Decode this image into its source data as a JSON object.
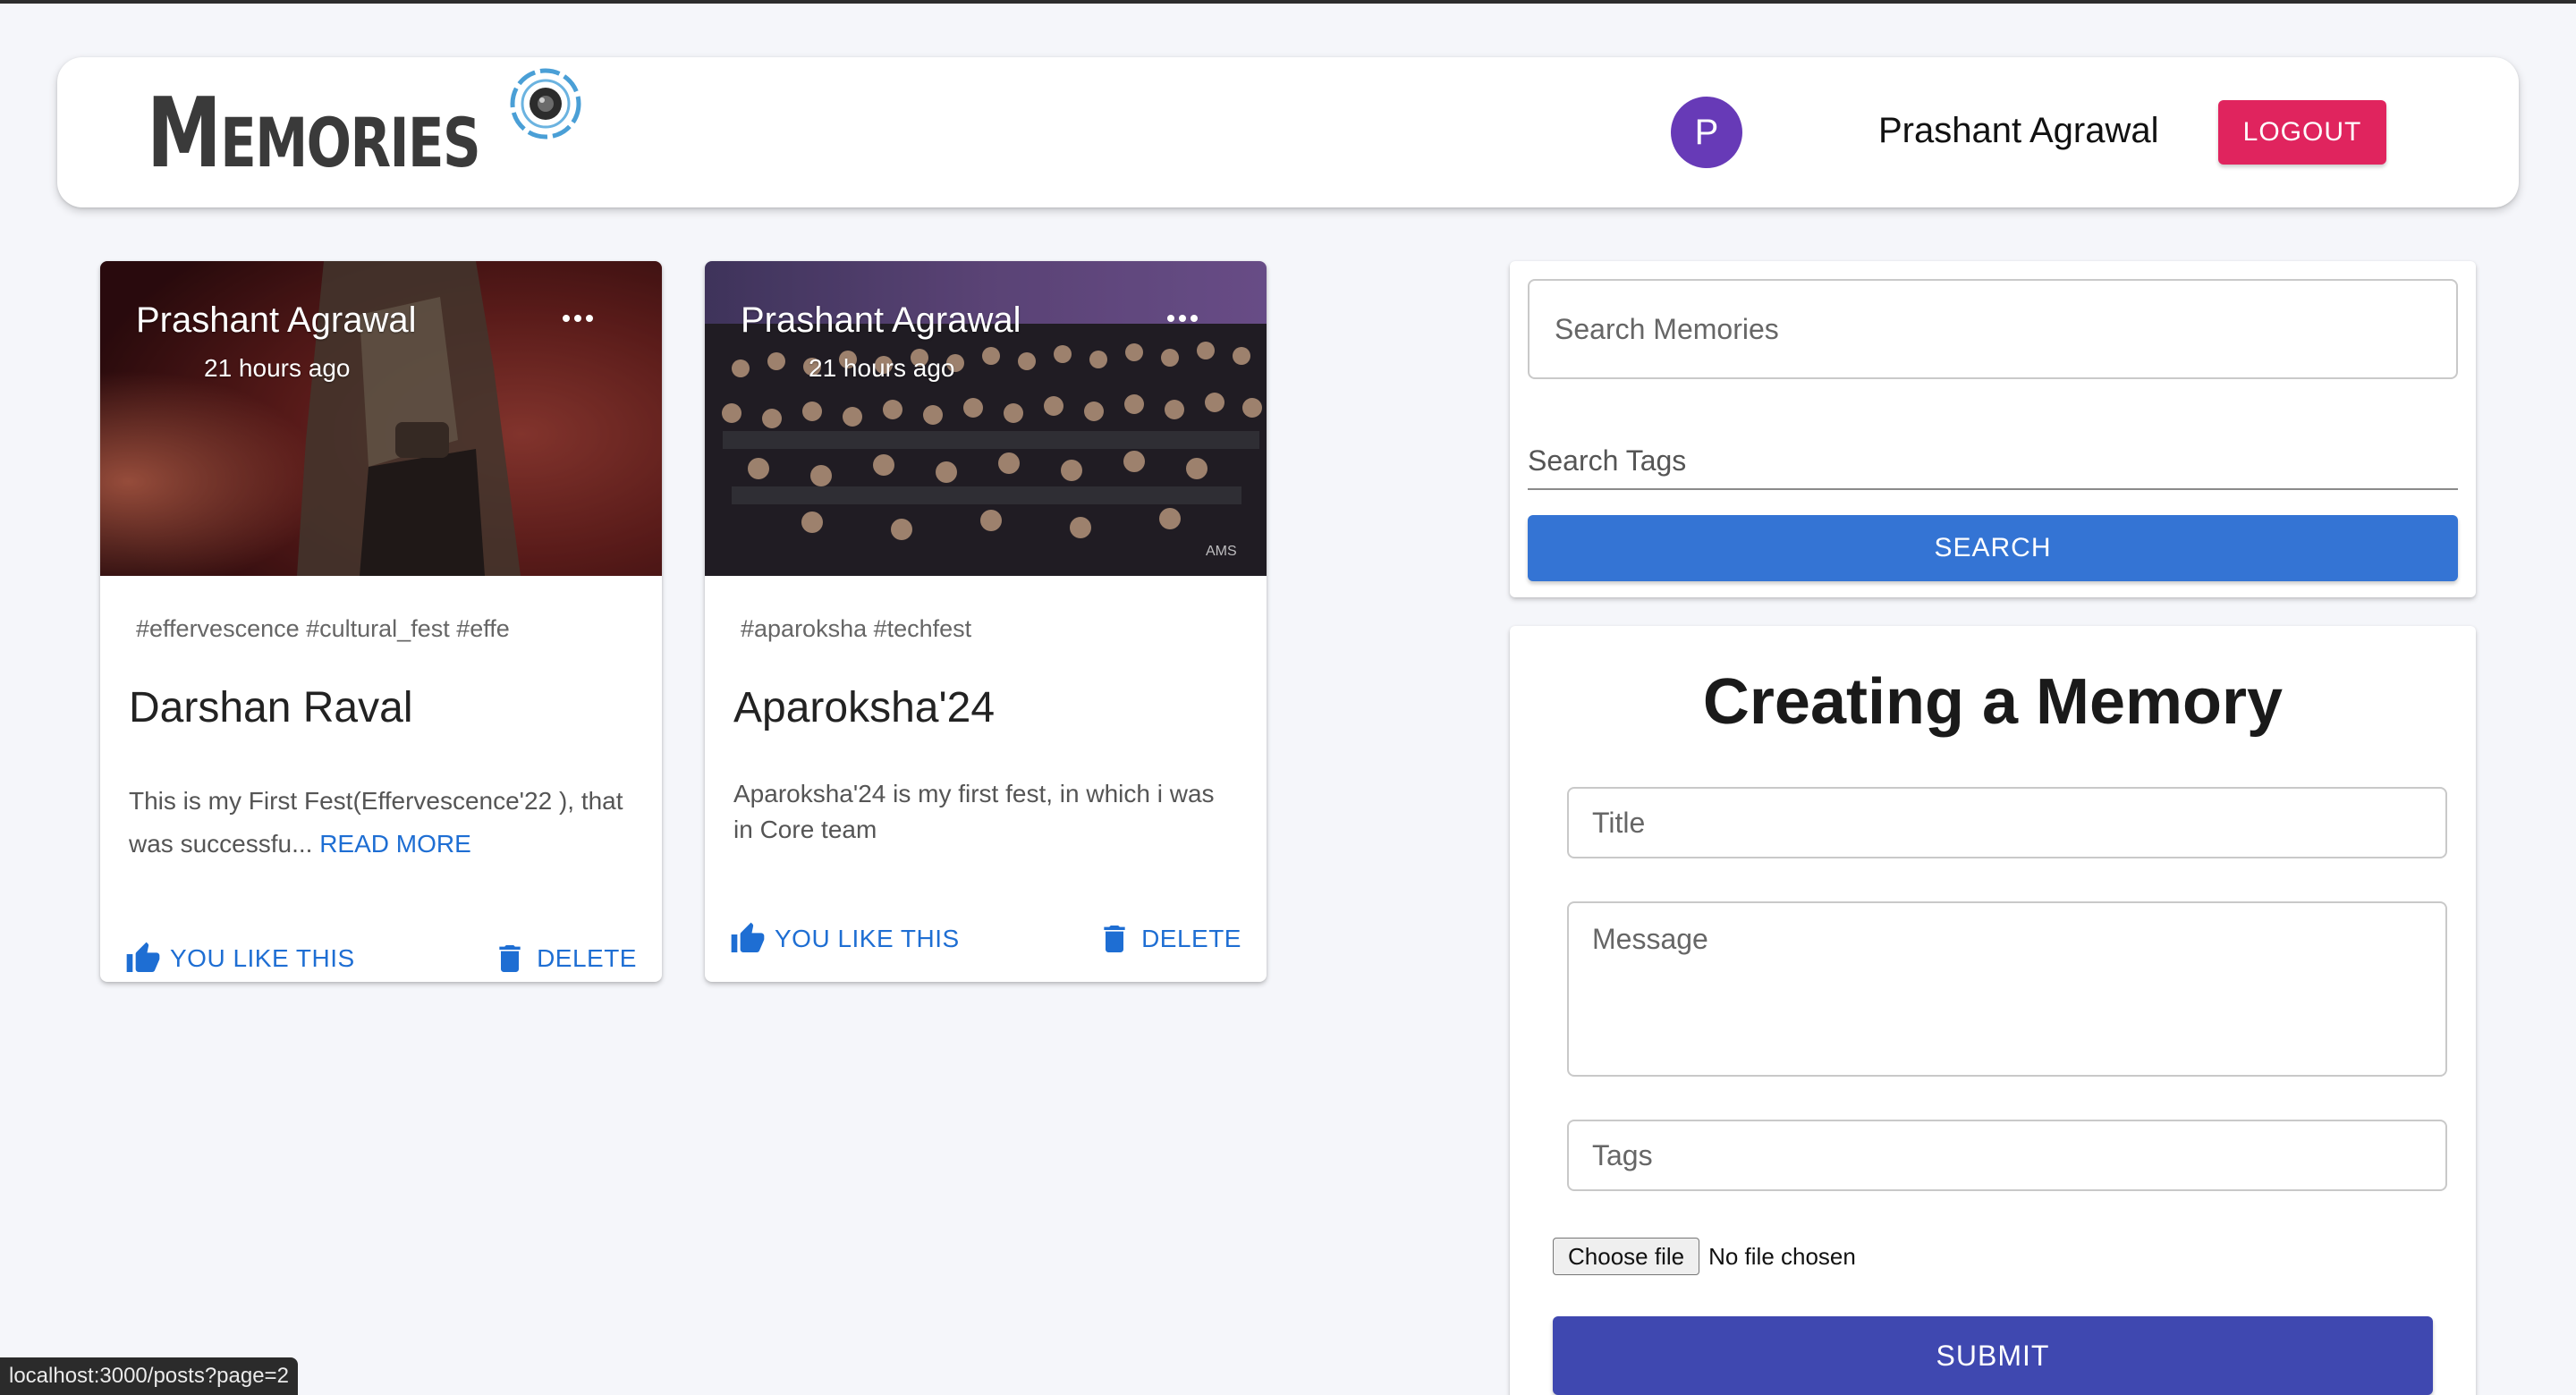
{
  "app": {
    "brand": "Memories",
    "user_initial": "P",
    "user_name": "Prashant Agrawal",
    "logout_label": "LOGOUT"
  },
  "posts": [
    {
      "author": "Prashant Agrawal",
      "time": "21 hours ago",
      "tags": "#effervescence #cultural_fest #effe",
      "title": "Darshan Raval",
      "message": "This is my First Fest(Effervescence'22 ), that was successfu...",
      "read_more": "READ MORE",
      "like_label": "YOU LIKE THIS",
      "delete_label": "DELETE"
    },
    {
      "author": "Prashant Agrawal",
      "time": "21 hours ago",
      "tags": "#aparoksha #techfest",
      "title": "Aparoksha'24",
      "message": "Aparoksha'24 is my first fest, in which i was in Core team",
      "like_label": "YOU LIKE THIS",
      "delete_label": "DELETE",
      "watermark": "AMS"
    }
  ],
  "search": {
    "memories_placeholder": "Search Memories",
    "tags_placeholder": "Search Tags",
    "button_label": "SEARCH"
  },
  "form": {
    "heading": "Creating a Memory",
    "title_placeholder": "Title",
    "message_placeholder": "Message",
    "tags_placeholder": "Tags",
    "file_button": "Choose file",
    "file_status": "No file chosen",
    "submit_label": "SUBMIT"
  },
  "statusbar": {
    "url": "localhost:3000/posts?page=2"
  },
  "colors": {
    "accent_blue": "#3474d4",
    "link_blue": "#1e6ed3",
    "logout_red": "#e0245e",
    "submit_indigo": "#3f48b0",
    "avatar_purple": "#673ab7",
    "background": "#f5f6fa"
  }
}
